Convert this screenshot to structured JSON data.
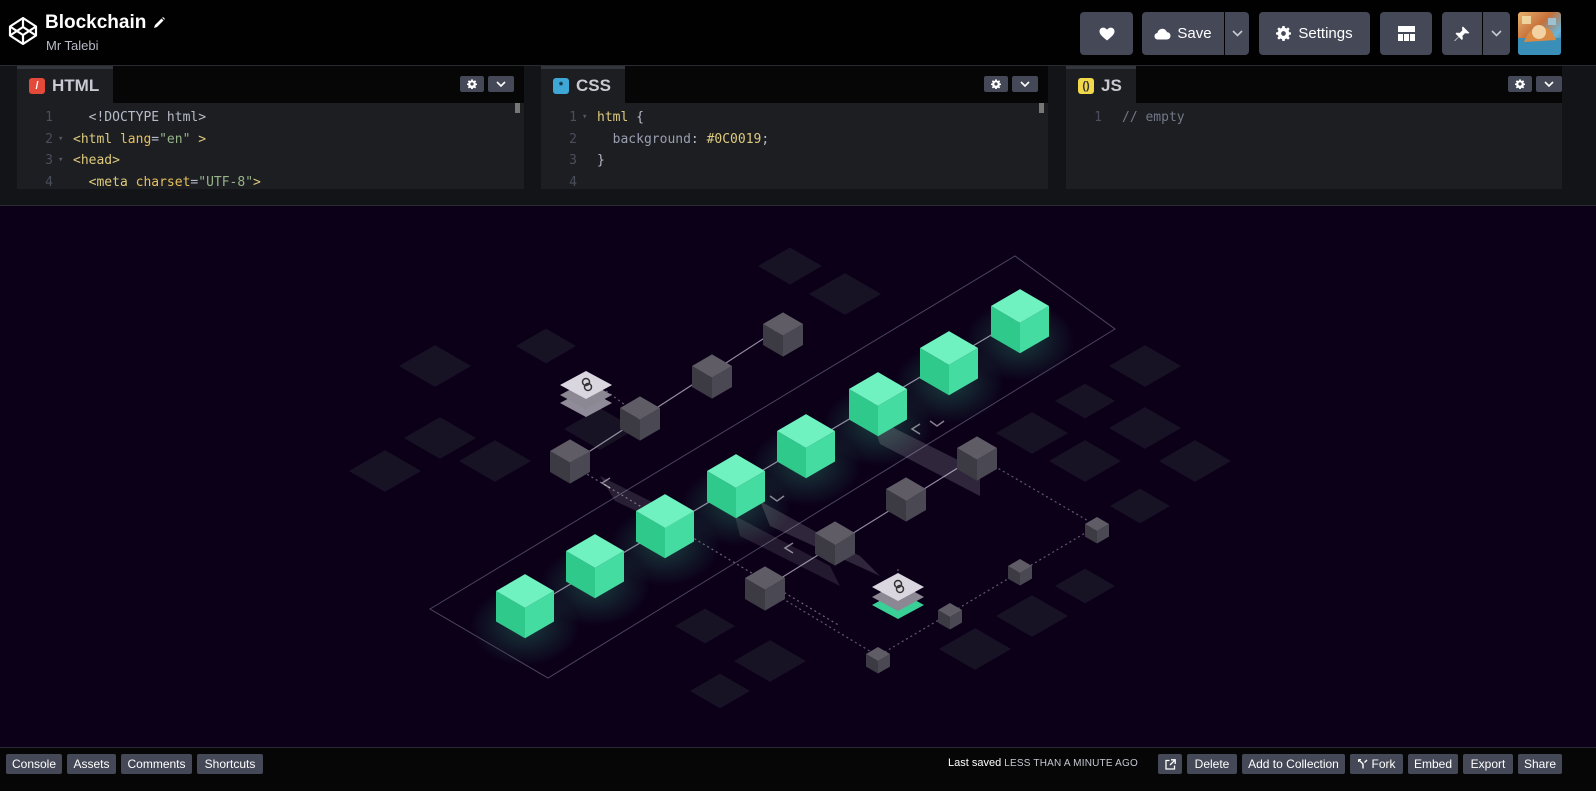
{
  "header": {
    "title": "Blockchain",
    "author": "Mr Talebi",
    "save_label": "Save",
    "settings_label": "Settings"
  },
  "editors": {
    "html": {
      "tab_label": "HTML",
      "icon_glyph": "/",
      "lines": [
        {
          "num": "1",
          "fold": "",
          "parts": [
            {
              "t": "  <!DOCTYPE html>",
              "c": "t-punct"
            }
          ]
        },
        {
          "num": "2",
          "fold": "▾",
          "parts": [
            {
              "t": "<html",
              "c": "t-tag"
            },
            {
              "t": " lang",
              "c": "t-attr"
            },
            {
              "t": "=",
              "c": "t-punct"
            },
            {
              "t": "\"en\"",
              "c": "t-str"
            },
            {
              "t": " >",
              "c": "t-tag"
            }
          ]
        },
        {
          "num": "3",
          "fold": "▾",
          "parts": [
            {
              "t": "<head>",
              "c": "t-tag"
            }
          ]
        },
        {
          "num": "4",
          "fold": "",
          "parts": [
            {
              "t": "  <meta",
              "c": "t-tag"
            },
            {
              "t": " charset",
              "c": "t-attr"
            },
            {
              "t": "=",
              "c": "t-punct"
            },
            {
              "t": "\"UTF-8\"",
              "c": "t-str"
            },
            {
              "t": ">",
              "c": "t-tag"
            }
          ]
        }
      ]
    },
    "css": {
      "tab_label": "CSS",
      "icon_glyph": "*",
      "lines": [
        {
          "num": "1",
          "fold": "▾",
          "parts": [
            {
              "t": "html",
              "c": "t-sel"
            },
            {
              "t": " {",
              "c": "t-punct"
            }
          ]
        },
        {
          "num": "2",
          "fold": "",
          "parts": [
            {
              "t": "  background",
              "c": "t-prop"
            },
            {
              "t": ": ",
              "c": "t-punct"
            },
            {
              "t": "#0C0019",
              "c": "t-val"
            },
            {
              "t": ";",
              "c": "t-punct"
            }
          ]
        },
        {
          "num": "3",
          "fold": "",
          "parts": [
            {
              "t": "}",
              "c": "t-punct"
            }
          ]
        },
        {
          "num": "4",
          "fold": "",
          "parts": []
        }
      ]
    },
    "js": {
      "tab_label": "JS",
      "icon_glyph": "()",
      "lines": [
        {
          "num": "1",
          "fold": "",
          "parts": [
            {
              "t": "// empty",
              "c": "t-com"
            }
          ]
        }
      ]
    }
  },
  "preview": {
    "background": "#0C0019",
    "accent_green": "#3ee6a4"
  },
  "footer": {
    "left_buttons": [
      "Console",
      "Assets",
      "Comments",
      "Shortcuts"
    ],
    "last_saved_label": "Last saved",
    "last_saved_value": "LESS THAN A MINUTE AGO",
    "delete_label": "Delete",
    "add_collection_label": "Add to Collection",
    "fork_label": "Fork",
    "embed_label": "Embed",
    "export_label": "Export",
    "share_label": "Share"
  },
  "icons": [
    "codepen-logo-icon",
    "pencil-icon",
    "heart-icon",
    "cloud-icon",
    "chevron-down-icon",
    "gear-icon",
    "layout-icon",
    "pin-icon",
    "external-link-icon",
    "fork-icon"
  ]
}
